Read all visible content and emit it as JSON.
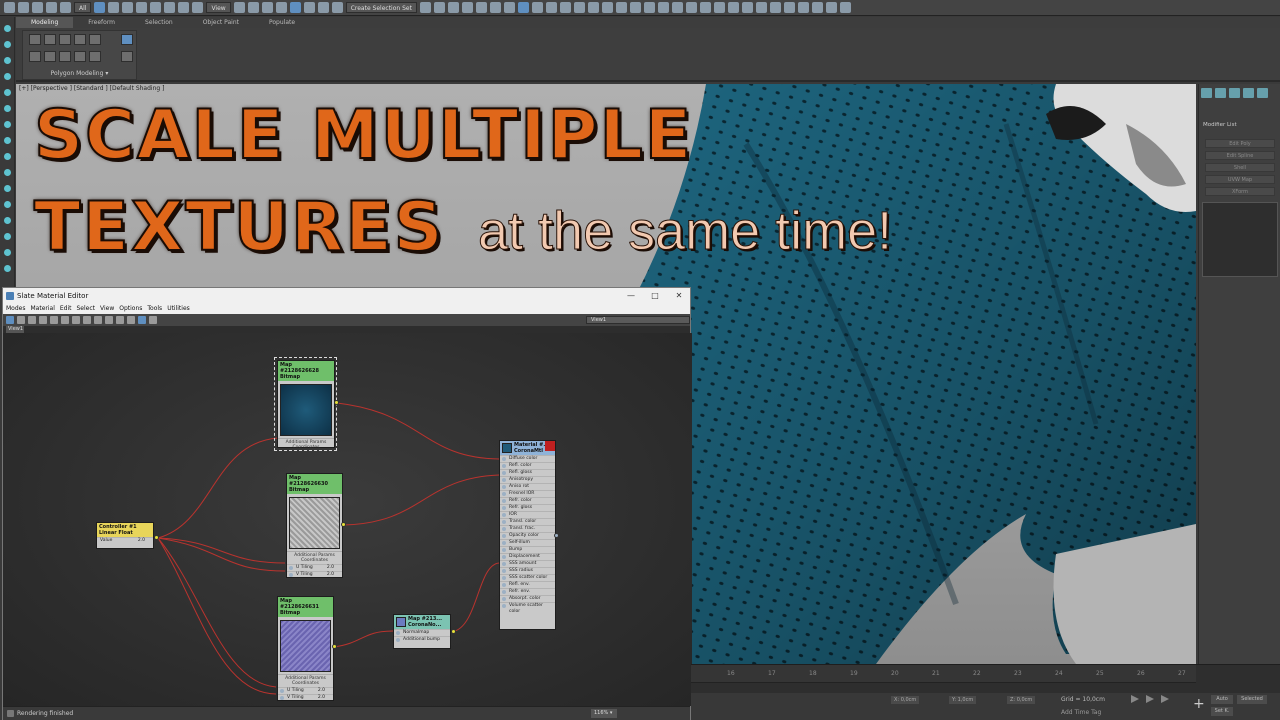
{
  "main_toolbar": {
    "filter_dropdown": "All",
    "view_dropdown": "View",
    "selection_set": "Create Selection Set"
  },
  "ribbon": {
    "tabs": [
      "Modeling",
      "Freeform",
      "Selection",
      "Object Paint",
      "Populate"
    ],
    "group_label": "Polygon Modeling ▾"
  },
  "viewport": {
    "label": "[+] [Perspective ] [Standard ] [Default Shading ]"
  },
  "overlay": {
    "line1": "SCALE MULTIPLE",
    "line2": "TEXTURES",
    "line3": "at the same time!"
  },
  "command_panel": {
    "modifier_list_label": "Modifier List",
    "buttons": [
      "Edit Poly",
      "Edit Spline",
      "Shell",
      "UVW Map",
      "XForm"
    ]
  },
  "slate": {
    "title": "Slate Material Editor",
    "menus": [
      "Modes",
      "Material",
      "Edit",
      "Select",
      "View",
      "Options",
      "Tools",
      "Utilities"
    ],
    "view_dropdown": "View1",
    "tab": "View1",
    "status": "Rendering finished",
    "zoom": "116% ▾",
    "nodes": {
      "bitmap1": {
        "title": "Map #2128626628",
        "subtitle": "Bitmap",
        "footer": "Additional Params Coordinates"
      },
      "bitmap2": {
        "title": "Map #2128626630",
        "subtitle": "Bitmap",
        "footer": "Additional Params Coordinates",
        "rows": [
          {
            "label": "U Tiling",
            "value": "2.0"
          },
          {
            "label": "V Tiling",
            "value": "2.0"
          }
        ]
      },
      "bitmap3": {
        "title": "Map #2128626631",
        "subtitle": "Bitmap",
        "footer": "Additional Params Coordinates",
        "rows": [
          {
            "label": "U Tiling",
            "value": "2.0"
          },
          {
            "label": "V Tiling",
            "value": "2.0"
          }
        ]
      },
      "controller": {
        "title": "Controller #1",
        "subtitle": "Linear Float",
        "row_label": "Value",
        "row_value": "2.0"
      },
      "normal": {
        "title": "Map #213...",
        "subtitle": "CoronaNo...",
        "rows": [
          "Normalmap",
          "Additional bump"
        ]
      },
      "material": {
        "title": "Material #...",
        "subtitle": "CoronaMtl",
        "rows": [
          "Diffuse color",
          "Refl. color",
          "Refl. gloss",
          "Anisotropy",
          "Aniso rot",
          "Fresnel IOR",
          "Refr. color",
          "Refr. gloss",
          "IOR",
          "Transl. color",
          "Transl. frac.",
          "Opacity color",
          "Self-illum",
          "Bump",
          "Displacement",
          "SSS amount",
          "SSS radius",
          "SSS scatter color",
          "Refl. env.",
          "Refr. env.",
          "Absorpt. color",
          "Volume scatter color"
        ]
      }
    }
  },
  "timeline": {
    "ticks": [
      "16",
      "17",
      "18",
      "19",
      "20",
      "21",
      "22",
      "23",
      "24",
      "25",
      "26",
      "27"
    ],
    "x_field": "X: 0,0cm",
    "y_field": "Y: 1,0cm",
    "z_field": "Z: 0,0cm",
    "grid": "Grid = 10,0cm",
    "time_tag": "Add Time Tag",
    "auto": "Auto",
    "selected": "Selected",
    "set_k": "Set K."
  },
  "colors": {
    "title_orange": "#e0671a",
    "cloth_teal": "#1f6b86",
    "wire_red": "#b9332e",
    "socket_yellow": "#e6e03a"
  }
}
